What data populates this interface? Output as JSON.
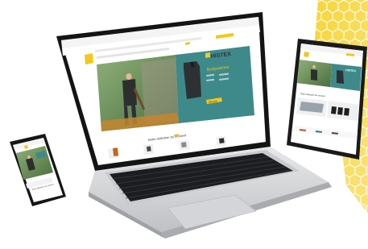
{
  "colors": {
    "brand_yellow": "#f2c81d",
    "hero_teal": "#3e8a8a",
    "laptop_silver": "#d9dadc",
    "keyboard_black": "#1c1d20",
    "screen_bezel": "#141414"
  },
  "laptop": {
    "section_heading": "Notre sélection du moment",
    "hero": {
      "brand": "HISTEX",
      "title": "Bodywarmer",
      "cta": "Découvrir"
    },
    "nav": [
      "Outillage",
      "Vêtements",
      "Chaussures",
      "Protection",
      "Entretien"
    ]
  },
  "tablet": {
    "section_heading": "Notre sélection du moment",
    "hero_brand": "HISTEX"
  },
  "phone": {
    "section_heading": "Notre sélection du moment"
  }
}
